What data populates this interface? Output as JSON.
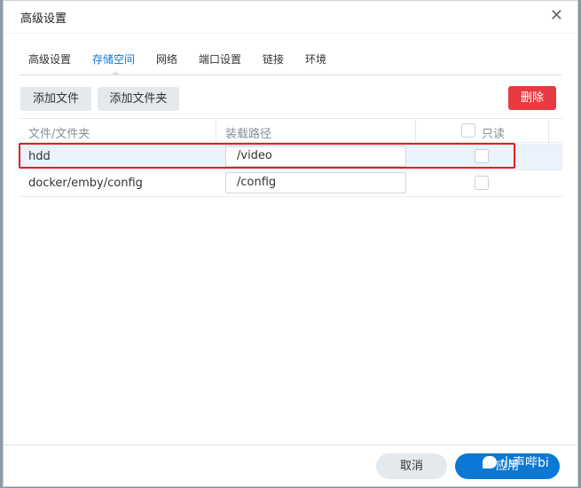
{
  "dialog": {
    "title": "高级设置",
    "close": "✕"
  },
  "tabs": [
    {
      "label": "高级设置"
    },
    {
      "label": "存储空间"
    },
    {
      "label": "网络"
    },
    {
      "label": "端口设置"
    },
    {
      "label": "链接"
    },
    {
      "label": "环境"
    }
  ],
  "active_tab": "存储空间",
  "toolbar": {
    "add_file": "添加文件",
    "add_folder": "添加文件夹",
    "delete": "删除"
  },
  "table": {
    "headers": {
      "folder": "文件/文件夹",
      "mount_path": "装载路径",
      "readonly": "只读"
    },
    "rows": [
      {
        "folder": "hdd",
        "mount_path": "/video",
        "readonly": false,
        "selected": true
      },
      {
        "folder": "docker/emby/config",
        "mount_path": "/config",
        "readonly": false,
        "selected": false
      }
    ]
  },
  "footer": {
    "cancel": "取消",
    "apply": "应用"
  },
  "watermark": "小声哔bi",
  "colors": {
    "accent": "#0a78d4",
    "danger": "#e83b41",
    "highlight": "#e02020"
  }
}
